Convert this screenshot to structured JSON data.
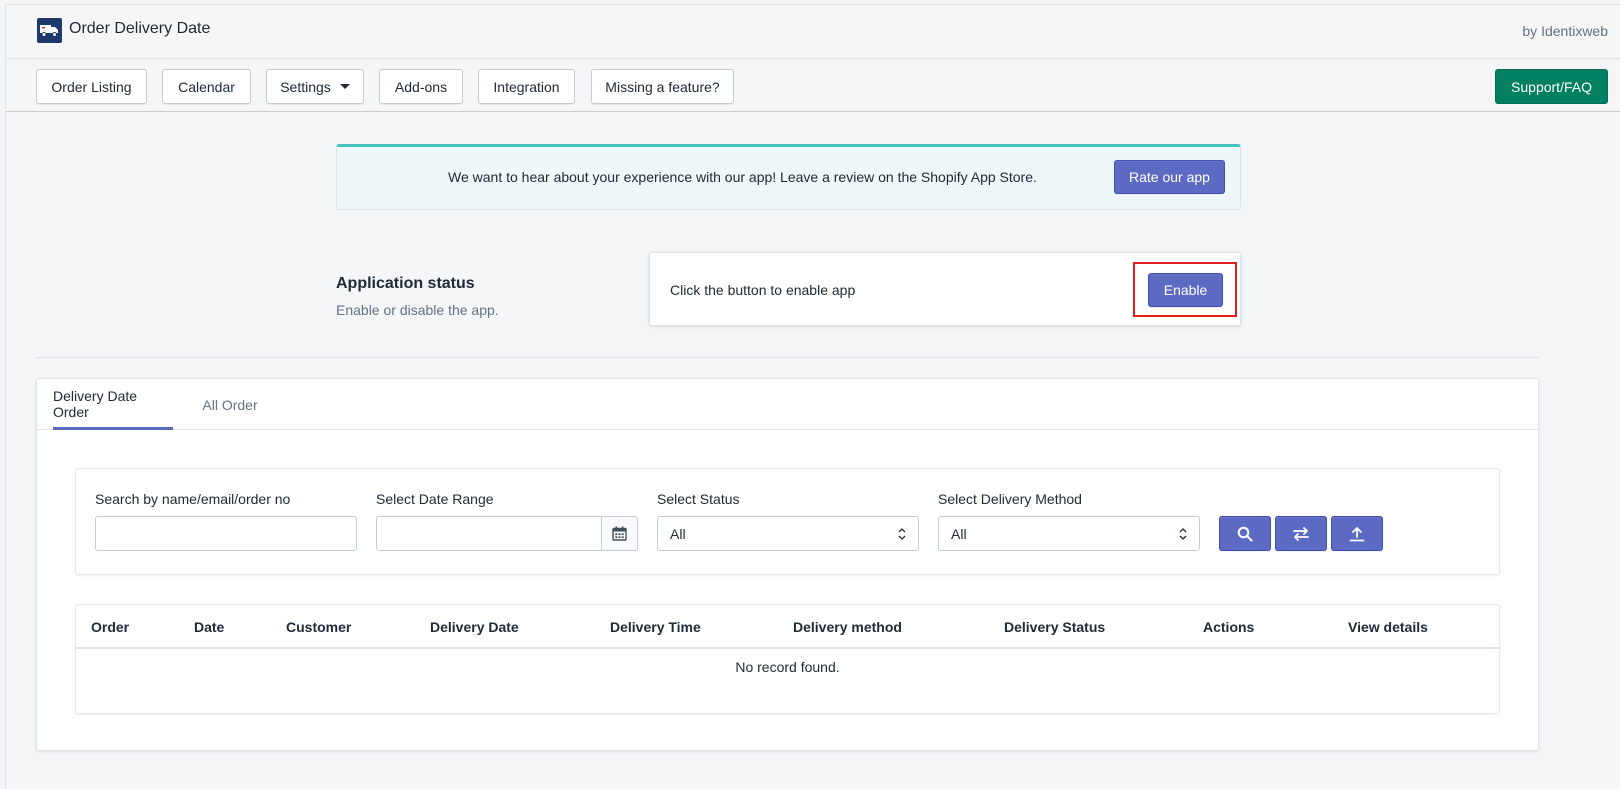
{
  "header": {
    "title": "Order Delivery Date",
    "byline": "by Identixweb",
    "logo_icon": "truck-icon"
  },
  "nav": {
    "items": [
      {
        "label": "Order Listing"
      },
      {
        "label": "Calendar"
      },
      {
        "label": "Settings"
      },
      {
        "label": "Add-ons"
      },
      {
        "label": "Integration"
      },
      {
        "label": "Missing a feature?"
      }
    ],
    "support_label": "Support/FAQ"
  },
  "banner": {
    "text": "We want to hear about your experience with our app! Leave a review on the Shopify App Store.",
    "button_label": "Rate our app"
  },
  "app_status": {
    "title": "Application status",
    "subtitle": "Enable or disable the app.",
    "card_text": "Click the button to enable app",
    "button_label": "Enable"
  },
  "tabs": [
    {
      "label": "Delivery Date Order",
      "active": true
    },
    {
      "label": "All Order",
      "active": false
    }
  ],
  "filters": {
    "search_label": "Search by name/email/order no",
    "search_value": "",
    "date_label": "Select Date Range",
    "date_value": "",
    "status_label": "Select Status",
    "status_value": "All",
    "method_label": "Select Delivery Method",
    "method_value": "All"
  },
  "table": {
    "columns": [
      "Order",
      "Date",
      "Customer",
      "Delivery Date",
      "Delivery Time",
      "Delivery method",
      "Delivery Status",
      "Actions",
      "View details"
    ],
    "empty_text": "No record found."
  },
  "colors": {
    "primary": "#5c6ac4",
    "support": "#008060",
    "highlight": "#e01e1e",
    "banner_accent": "#47c1bf"
  }
}
